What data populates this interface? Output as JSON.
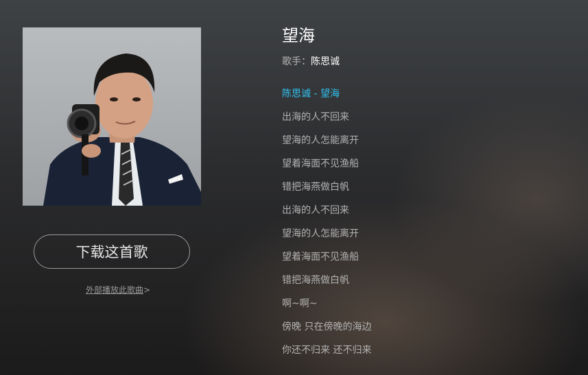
{
  "song": {
    "title": "望海",
    "artist_label": "歌手：",
    "artist": "陈思诚"
  },
  "actions": {
    "download_label": "下载这首歌",
    "external_play_label": "外部播放此歌曲",
    "external_play_arrow": ">"
  },
  "lyrics": [
    "陈思诚 - 望海",
    "出海的人不回来",
    "望海的人怎能离开",
    "望着海面不见渔船",
    "错把海燕做白帆",
    "出海的人不回来",
    "望海的人怎能离开",
    "望着海面不见渔船",
    "错把海燕做白帆",
    "啊~啊~",
    "傍晚 只在傍晚的海边",
    "你还不归来 还不归来"
  ],
  "colors": {
    "active_lyric": "#31c2f0",
    "title": "#ffffff"
  },
  "icons": {
    "album_cover": "album-cover-image"
  }
}
